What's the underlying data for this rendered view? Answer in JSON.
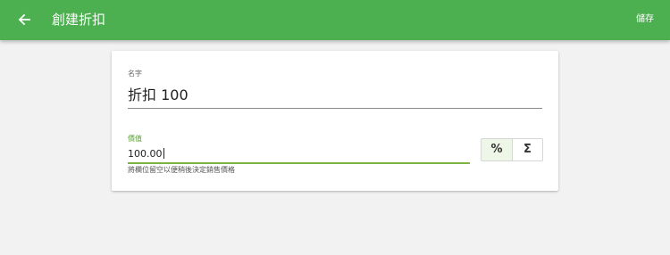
{
  "appbar": {
    "title": "創建折扣",
    "save_label": "儲存",
    "back_icon": "arrow-left-icon",
    "color": "#4caf50"
  },
  "form": {
    "name": {
      "label": "名字",
      "value": "折扣 100"
    },
    "value": {
      "label": "價值",
      "value": "100.00",
      "helper": "將欄位留空以便稍後決定銷售價格",
      "focus_color": "#7cb342"
    },
    "type_toggle": {
      "percent_symbol": "%",
      "sum_symbol": "Σ",
      "selected": "percent"
    }
  }
}
